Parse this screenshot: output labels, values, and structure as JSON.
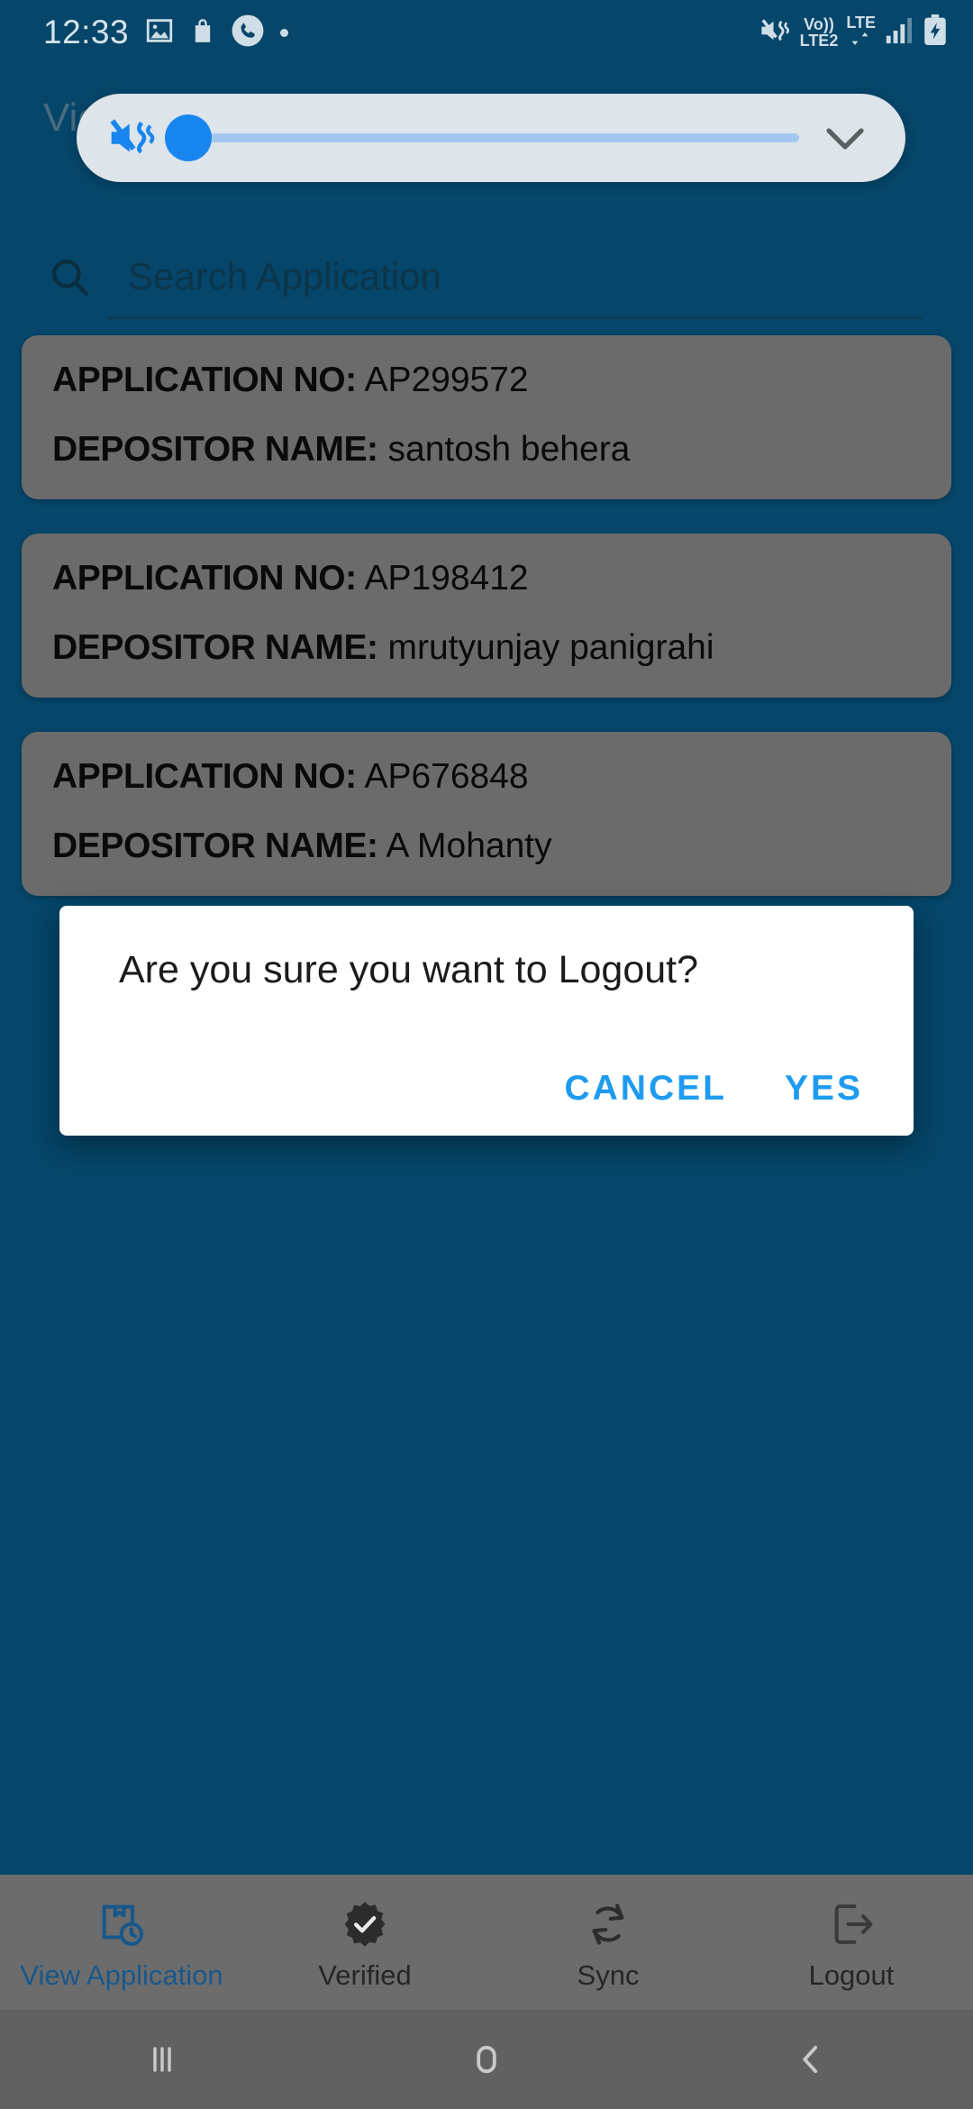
{
  "status_bar": {
    "time": "12:33",
    "left_icons": [
      "gallery-icon",
      "shopping-bag-icon",
      "phone-circle-icon",
      "dot-indicator"
    ],
    "volte_label": "Vo))",
    "sim2_label": "LTE2",
    "lte_label": "LTE",
    "right_icons": [
      "mute-vibrate-icon",
      "data-transfer-icon",
      "signal-bars-icon",
      "battery-charging-icon"
    ]
  },
  "volume_panel": {
    "icon": "volume-mute-vibrate-icon",
    "level": 0,
    "expand_icon": "chevron-down-icon",
    "track_color": "#a3c8ef",
    "thumb_color": "#1886ee",
    "panel_color": "#dde4ea"
  },
  "app_bar": {
    "title": "View Application"
  },
  "search": {
    "icon": "search-icon",
    "placeholder": "Search Application",
    "value": ""
  },
  "cards": [
    {
      "application_label": "APPLICATION NO:",
      "application_no": "AP299572",
      "depositor_label": "DEPOSITOR NAME:",
      "depositor_name": "santosh behera"
    },
    {
      "application_label": "APPLICATION NO:",
      "application_no": "AP198412",
      "depositor_label": "DEPOSITOR NAME:",
      "depositor_name": "mrutyunjay panigrahi"
    },
    {
      "application_label": "APPLICATION NO:",
      "application_no": "AP676848",
      "depositor_label": "DEPOSITOR NAME:",
      "depositor_name": "A Mohanty"
    }
  ],
  "dialog": {
    "message": "Are you sure you want to Logout?",
    "cancel_label": "CANCEL",
    "confirm_label": "YES",
    "button_color": "#1e9bf0",
    "background": "#ffffff"
  },
  "bottom_nav": {
    "items": [
      {
        "label": "View Application",
        "icon": "package-clock-icon",
        "active": true
      },
      {
        "label": "Verified",
        "icon": "verified-badge-icon",
        "active": false
      },
      {
        "label": "Sync",
        "icon": "sync-refresh-icon",
        "active": false
      },
      {
        "label": "Logout",
        "icon": "logout-exit-icon",
        "active": false
      }
    ],
    "active_color": "#19578a",
    "background": "#6c6c6c"
  },
  "system_nav": {
    "recents_icon": "recents-icon",
    "home_icon": "home-icon",
    "back_icon": "back-icon"
  },
  "theme": {
    "background": "#05466a",
    "card_background": "#6b6b6b"
  }
}
